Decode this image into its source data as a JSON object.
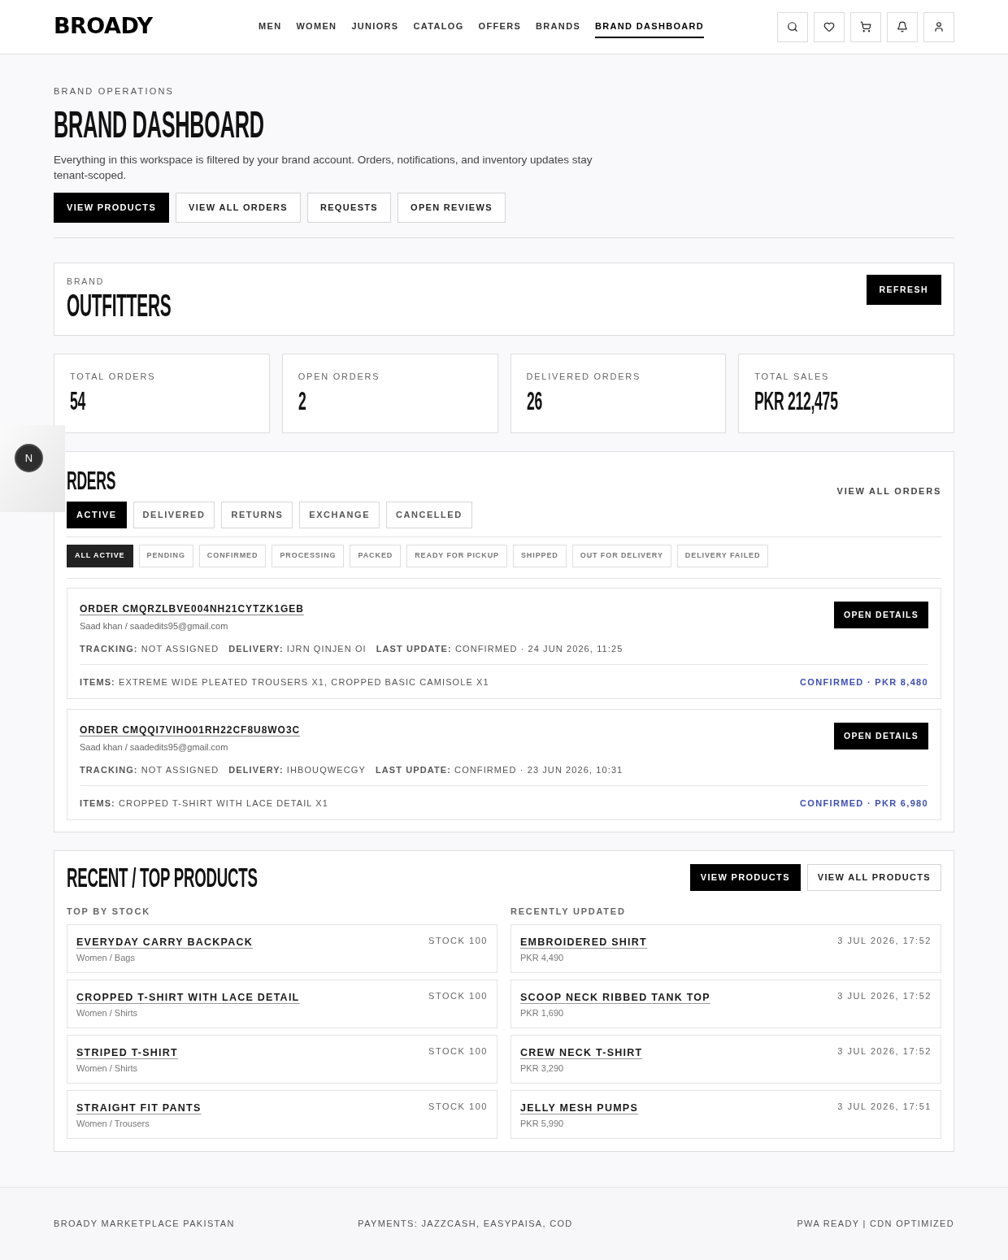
{
  "header": {
    "logo": "BROADY",
    "nav": [
      {
        "label": "MEN",
        "selected": false
      },
      {
        "label": "WOMEN",
        "selected": false
      },
      {
        "label": "JUNIORS",
        "selected": false
      },
      {
        "label": "CATALOG",
        "selected": false
      },
      {
        "label": "OFFERS",
        "selected": false
      },
      {
        "label": "BRANDS",
        "selected": false
      },
      {
        "label": "BRAND DASHBOARD",
        "selected": true
      }
    ]
  },
  "page": {
    "eyebrow": "BRAND OPERATIONS",
    "title": "BRAND DASHBOARD",
    "description": "Everything in this workspace is filtered by your brand account. Orders, notifications, and inventory updates stay tenant-scoped.",
    "actions": [
      {
        "label": "VIEW PRODUCTS",
        "kind": "primary"
      },
      {
        "label": "VIEW ALL ORDERS",
        "kind": "secondary"
      },
      {
        "label": "REQUESTS",
        "kind": "secondary"
      },
      {
        "label": "OPEN REVIEWS",
        "kind": "secondary"
      }
    ]
  },
  "brand_card": {
    "label": "BRAND",
    "name": "OUTFITTERS",
    "button": "REFRESH"
  },
  "stats": [
    {
      "label": "TOTAL ORDERS",
      "value": "54"
    },
    {
      "label": "OPEN ORDERS",
      "value": "2"
    },
    {
      "label": "DELIVERED ORDERS",
      "value": "26"
    },
    {
      "label": "TOTAL SALES",
      "value": "PKR 212,475"
    }
  ],
  "orders": {
    "title": "RDERS",
    "link": "VIEW ALL ORDERS",
    "tabs": [
      {
        "label": "ACTIVE",
        "selected": true
      },
      {
        "label": "DELIVERED",
        "selected": false
      },
      {
        "label": "RETURNS",
        "selected": false
      },
      {
        "label": "EXCHANGE",
        "selected": false
      },
      {
        "label": "CANCELLED",
        "selected": false
      }
    ],
    "filters": [
      {
        "label": "ALL ACTIVE",
        "selected": true
      },
      {
        "label": "PENDING",
        "selected": false
      },
      {
        "label": "CONFIRMED",
        "selected": false
      },
      {
        "label": "PROCESSING",
        "selected": false
      },
      {
        "label": "PACKED",
        "selected": false
      },
      {
        "label": "READY FOR PICKUP",
        "selected": false
      },
      {
        "label": "SHIPPED",
        "selected": false
      },
      {
        "label": "OUT FOR DELIVERY",
        "selected": false
      },
      {
        "label": "DELIVERY FAILED",
        "selected": false
      }
    ],
    "list": [
      {
        "id": "ORDER CMQRZLBVE004NH21CYTZK1GEB",
        "customer": "Saad khan / saadedits95@gmail.com",
        "meta": [
          "**TRACKING:** NOT ASSIGNED",
          "**DELIVERY:** IJRN QINJEN OI",
          "**LAST UPDATE:** CONFIRMED · 24 JUN 2026, 11:25"
        ],
        "items": "**ITEMS:** EXTREME WIDE PLEATED TROUSERS X1, CROPPED BASIC CAMISOLE X1",
        "status": "CONFIRMED · PKR 8,480",
        "button": "OPEN DETAILS"
      },
      {
        "id": "ORDER CMQQI7VIHO01RH22CF8U8WO3C",
        "customer": "Saad khan / saadedits95@gmail.com",
        "meta": [
          "**TRACKING:** NOT ASSIGNED",
          "**DELIVERY:** IHBOUQWECGY",
          "**LAST UPDATE:** CONFIRMED · 23 JUN 2026, 10:31"
        ],
        "items": "**ITEMS:** CROPPED T-SHIRT WITH LACE DETAIL X1",
        "status": "CONFIRMED · PKR 6,980",
        "button": "OPEN DETAILS"
      }
    ]
  },
  "products": {
    "title": "RECENT / TOP PRODUCTS",
    "actions": [
      {
        "label": "VIEW PRODUCTS",
        "kind": "primary"
      },
      {
        "label": "VIEW ALL PRODUCTS",
        "kind": "secondary"
      }
    ],
    "top_by_stock": {
      "heading": "TOP BY STOCK",
      "items": [
        {
          "name": "EVERYDAY CARRY BACKPACK",
          "detail": "Women / Bags",
          "aside": "STOCK 100"
        },
        {
          "name": "CROPPED T-SHIRT WITH LACE DETAIL",
          "detail": "Women / Shirts",
          "aside": "STOCK 100"
        },
        {
          "name": "STRIPED T-SHIRT",
          "detail": "Women / Shirts",
          "aside": "STOCK 100"
        },
        {
          "name": "STRAIGHT FIT PANTS",
          "detail": "Women / Trousers",
          "aside": "STOCK 100"
        }
      ]
    },
    "recently_updated": {
      "heading": "RECENTLY UPDATED",
      "items": [
        {
          "name": "EMBROIDERED SHIRT",
          "detail": "PKR 4,490",
          "aside": "3 JUL 2026, 17:52"
        },
        {
          "name": "SCOOP NECK RIBBED TANK TOP",
          "detail": "PKR 1,690",
          "aside": "3 JUL 2026, 17:52"
        },
        {
          "name": "CREW NECK T-SHIRT",
          "detail": "PKR 3,290",
          "aside": "3 JUL 2026, 17:52"
        },
        {
          "name": "JELLY MESH PUMPS",
          "detail": "PKR 5,990",
          "aside": "3 JUL 2026, 17:51"
        }
      ]
    }
  },
  "dev_badge": {
    "letter": "N"
  },
  "footer": {
    "left": "BROADY MARKETPLACE PAKISTAN",
    "center": "PAYMENTS: JAZZCASH, EASYPAISA, COD",
    "right": "PWA READY | CDN OPTIMIZED"
  }
}
